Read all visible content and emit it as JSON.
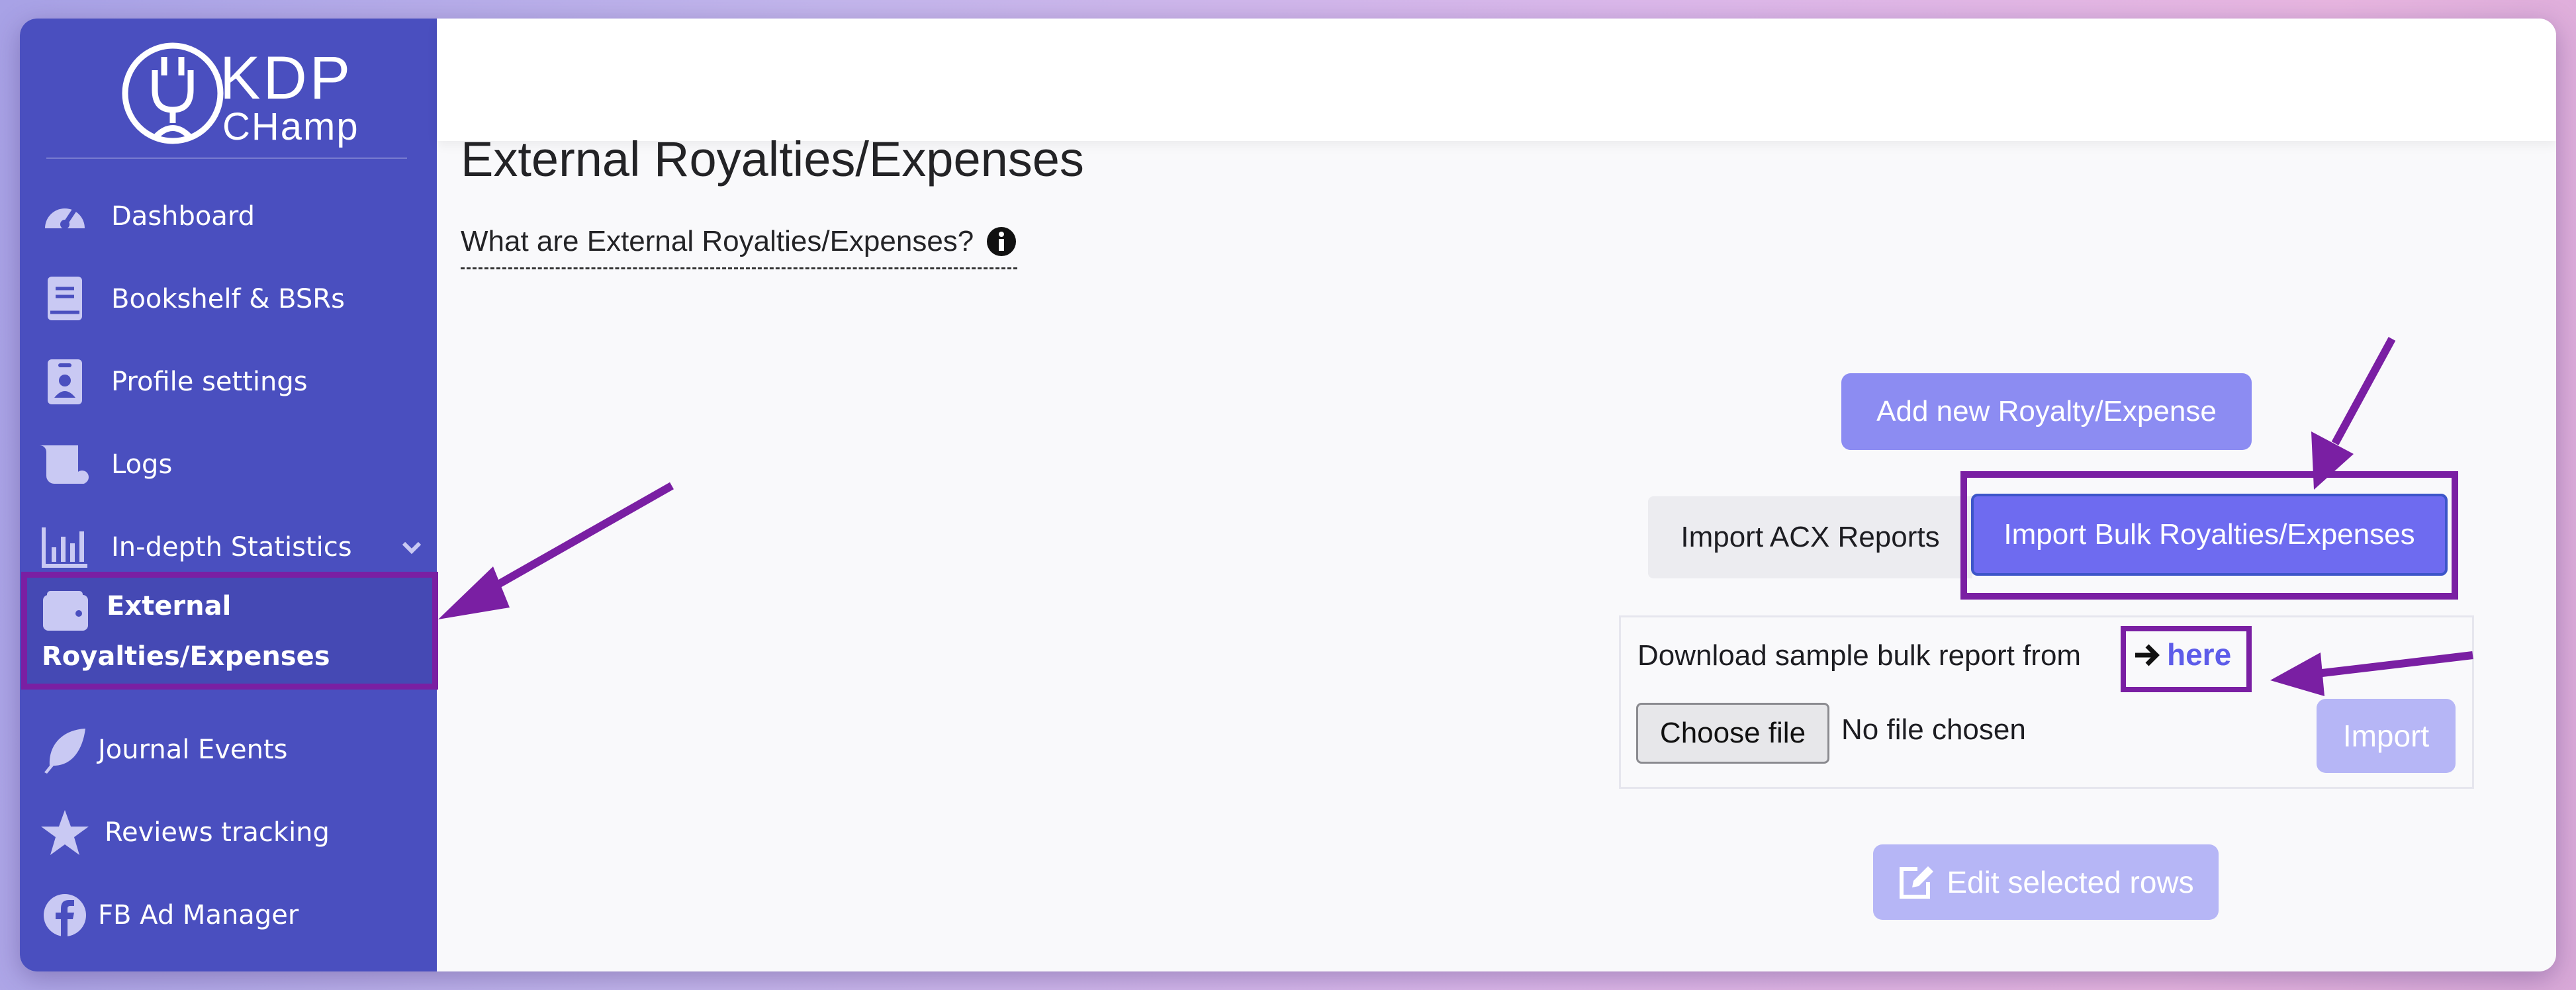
{
  "logo": {
    "line1": "KDP",
    "line2": "CHamp"
  },
  "sidebar": {
    "items": [
      {
        "label": "Dashboard",
        "icon": "gauge-icon"
      },
      {
        "label": "Bookshelf & BSRs",
        "icon": "book-icon"
      },
      {
        "label": "Profile settings",
        "icon": "id-badge-icon"
      },
      {
        "label": "Logs",
        "icon": "scroll-icon"
      },
      {
        "label": "In-depth Statistics",
        "icon": "chart-icon",
        "expandable": true
      },
      {
        "label_line1": "External",
        "label_line2": "Royalties/Expenses",
        "icon": "wallet-icon",
        "active": true
      },
      {
        "label": "Journal Events",
        "icon": "feather-icon"
      },
      {
        "label": "Reviews tracking",
        "icon": "star-icon"
      },
      {
        "label": "FB Ad Manager",
        "icon": "facebook-icon"
      }
    ]
  },
  "main": {
    "title": "External Royalties/Expenses",
    "help_text": "What are External Royalties/Expenses?",
    "add_button": "Add new Royalty/Expense",
    "tabs": [
      {
        "label": "Import ACX Reports",
        "active": false
      },
      {
        "label": "Import Bulk Royalties/Expenses",
        "active": true
      }
    ],
    "download_text": "Download sample bulk report from",
    "download_link": "here",
    "choose_file": "Choose file",
    "file_status": "No file chosen",
    "import_button": "Import",
    "edit_button": "Edit selected rows"
  },
  "colors": {
    "sidebar": "#4a4fbf",
    "accent": "#6e6bf0",
    "highlight": "#7a1fa3",
    "disabled_button": "#b6b6f6"
  }
}
